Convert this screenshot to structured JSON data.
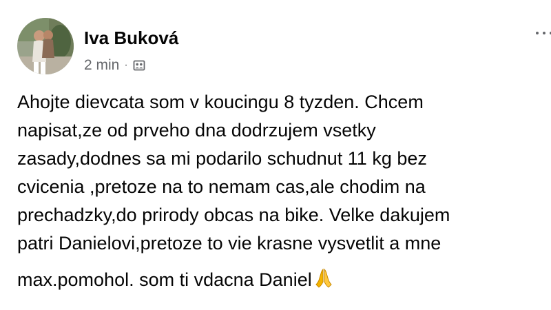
{
  "post": {
    "author": {
      "name": "Iva Buková",
      "avatar_icon": "profile-photo"
    },
    "meta": {
      "time": "2 min",
      "separator": "·",
      "audience_icon": "group-audience-icon"
    },
    "more_icon": "more-options-icon",
    "body_lines": [
      "Ahojte dievcata som v koucingu 8 tyzden. Chcem",
      "napisat,ze od prveho dna dodrzujem vsetky",
      "zasady,dodnes sa mi podarilo schudnut 11 kg bez",
      "cvicenia ,pretoze na to nemam cas,ale chodim na",
      "prechadzky,do prirody obcas na bike. Velke dakujem",
      "patri Danielovi,pretoze to vie krasne vysvetlit a mne",
      "max.pomohol. som ti vdacna Daniel"
    ],
    "emoji": "🙏",
    "colors": {
      "text": "#050505",
      "secondary": "#65676b",
      "emoji": "#f4b400"
    }
  }
}
